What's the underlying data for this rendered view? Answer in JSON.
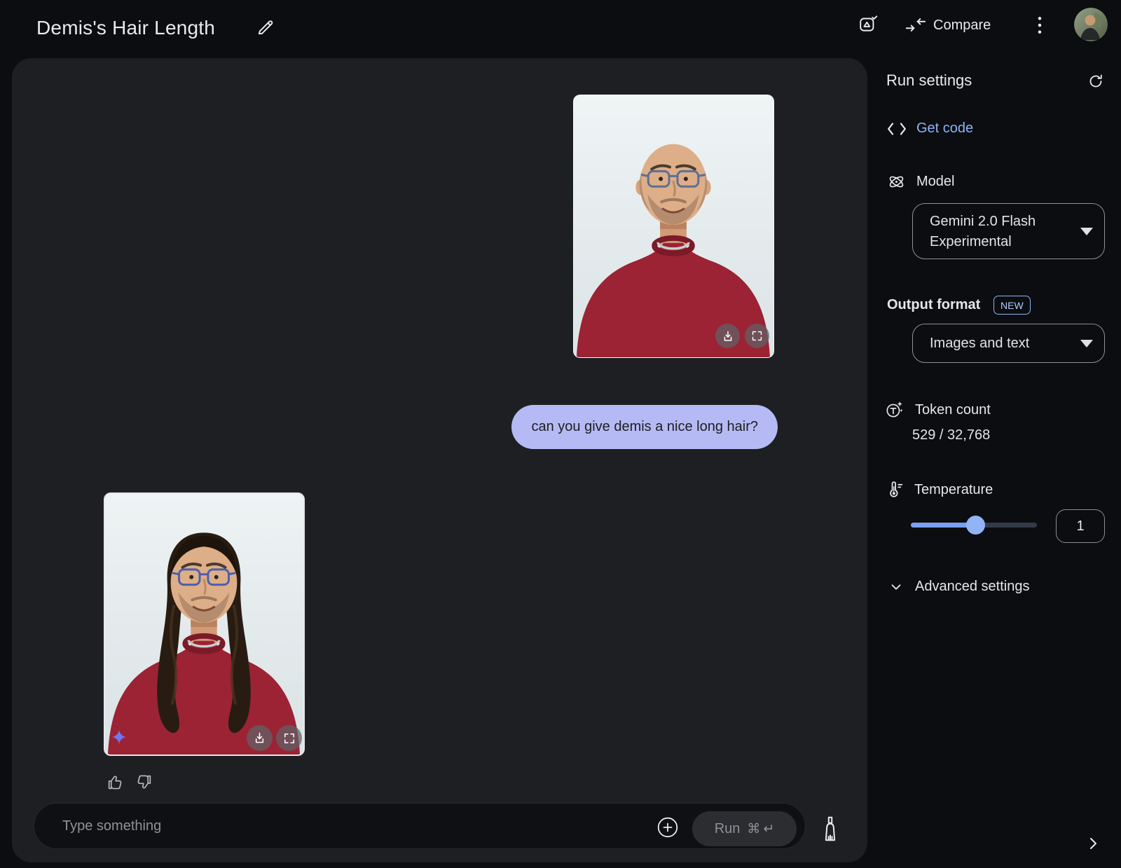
{
  "header": {
    "title": "Demis's Hair Length",
    "compare_label": "Compare"
  },
  "chat": {
    "user_message": "can you give demis a nice long hair?"
  },
  "composer": {
    "placeholder": "Type something",
    "run_label": "Run",
    "shortcut_cmd": "⌘",
    "shortcut_enter": "↵"
  },
  "run_settings": {
    "title": "Run settings",
    "get_code": "Get code",
    "model": {
      "label": "Model",
      "value": "Gemini 2.0 Flash Experimental"
    },
    "output_format": {
      "label": "Output format",
      "badge": "NEW",
      "value": "Images and text"
    },
    "token_count": {
      "label": "Token count",
      "value": "529 / 32,768"
    },
    "temperature": {
      "label": "Temperature",
      "value": "1",
      "percent": 51
    },
    "advanced": "Advanced settings"
  },
  "colors": {
    "accent_blue": "#8ab4f8",
    "user_bubble": "#b6baf4",
    "page_bg": "#0b0d10",
    "panel_bg": "#1d1f22",
    "sweater_red": "#9b2334"
  }
}
